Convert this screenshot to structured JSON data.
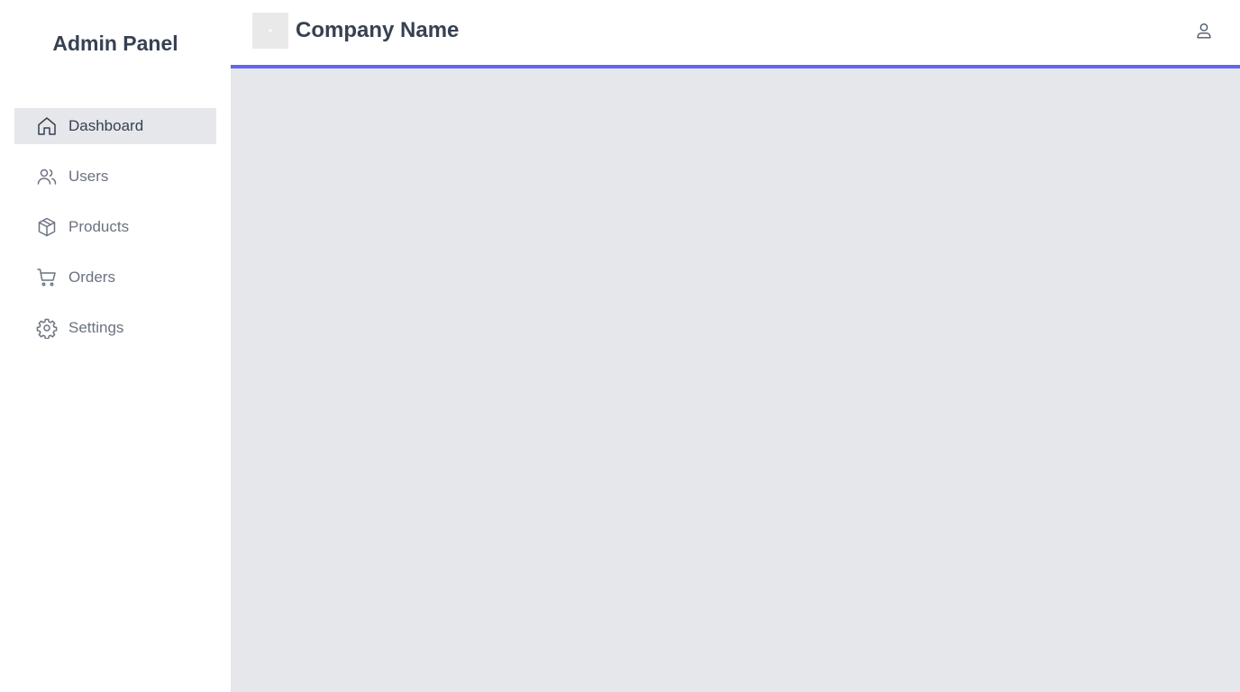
{
  "sidebar": {
    "title": "Admin Panel",
    "items": [
      {
        "label": "Dashboard",
        "icon": "home-icon",
        "active": true
      },
      {
        "label": "Users",
        "icon": "users-icon",
        "active": false
      },
      {
        "label": "Products",
        "icon": "box-icon",
        "active": false
      },
      {
        "label": "Orders",
        "icon": "cart-icon",
        "active": false
      },
      {
        "label": "Settings",
        "icon": "gear-icon",
        "active": false
      }
    ]
  },
  "header": {
    "company_name": "Company Name",
    "logo_icon": "logo-placeholder",
    "user_icon": "user-icon",
    "accent_color": "#6366f1"
  },
  "colors": {
    "content_bg": "#e5e7eb",
    "active_item_bg": "#e5e7eb",
    "text_dark": "#374151",
    "text_muted": "#6b7280"
  }
}
